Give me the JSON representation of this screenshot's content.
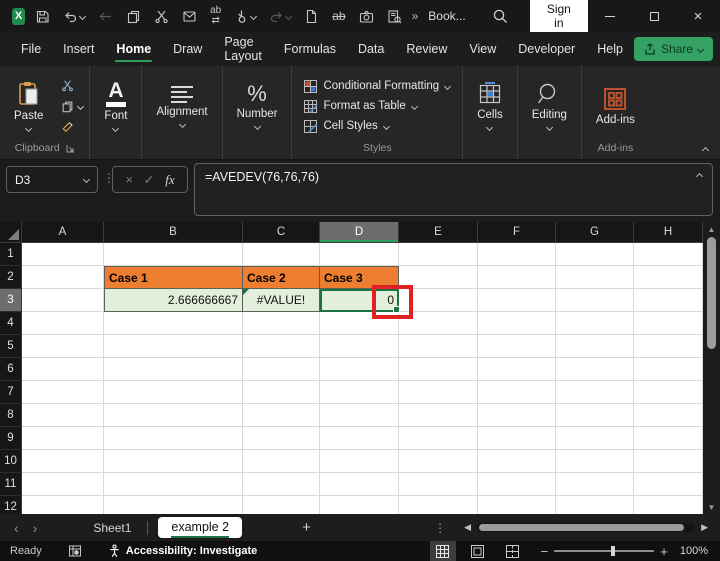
{
  "titlebar": {
    "document_title": "Book...",
    "sign_in_label": "Sign in",
    "overflow_glyph": "»",
    "find_replace_glyph": "ab",
    "find_replace_arrows": "⇄",
    "strikethrough_glyph": "ab",
    "excel_logo_glyph": "X"
  },
  "menubar": {
    "tabs": [
      {
        "label": "File",
        "active": false
      },
      {
        "label": "Insert",
        "active": false
      },
      {
        "label": "Home",
        "active": true
      },
      {
        "label": "Draw",
        "active": false
      },
      {
        "label": "Page Layout",
        "active": false
      },
      {
        "label": "Formulas",
        "active": false
      },
      {
        "label": "Data",
        "active": false
      },
      {
        "label": "Review",
        "active": false
      },
      {
        "label": "View",
        "active": false
      },
      {
        "label": "Developer",
        "active": false
      },
      {
        "label": "Help",
        "active": false
      }
    ],
    "share_label": "Share"
  },
  "ribbon": {
    "paste_label": "Paste",
    "clipboard_group_label": "Clipboard",
    "font_label": "Font",
    "alignment_label": "Alignment",
    "number_label": "Number",
    "number_glyph": "%",
    "conditional_formatting_label": "Conditional Formatting",
    "format_as_table_label": "Format as Table",
    "cell_styles_label": "Cell Styles",
    "styles_group_label": "Styles",
    "cells_label": "Cells",
    "editing_label": "Editing",
    "addins_label": "Add-ins",
    "addins_group_label": "Add-ins",
    "font_icon_glyph": "A"
  },
  "formula_bar": {
    "name_box_value": "D3",
    "cancel_glyph": "×",
    "enter_glyph": "✓",
    "fx_label": "fx",
    "formula": "=AVEDEV(76,76,76)"
  },
  "grid": {
    "column_headers": [
      "A",
      "B",
      "C",
      "D",
      "E",
      "F",
      "G",
      "H"
    ],
    "selected_column": "D",
    "row_headers": [
      "1",
      "2",
      "3",
      "4",
      "5",
      "6",
      "7",
      "8",
      "9",
      "10",
      "11",
      "12"
    ],
    "selected_row": "3",
    "cells": [
      {
        "ref": "B2",
        "value": "Case 1",
        "kind": "case-header"
      },
      {
        "ref": "C2",
        "value": "Case 2",
        "kind": "case-header"
      },
      {
        "ref": "D2",
        "value": "Case 3",
        "kind": "case-header"
      },
      {
        "ref": "B3",
        "value": "2.666666667",
        "kind": "result"
      },
      {
        "ref": "C3",
        "value": "#VALUE!",
        "kind": "error"
      },
      {
        "ref": "D3",
        "value": "0",
        "kind": "result-selected"
      }
    ]
  },
  "sheet_bar": {
    "tabs": [
      {
        "label": "Sheet1",
        "active": false
      },
      {
        "label": "example 2",
        "active": true
      }
    ],
    "add_sheet_glyph": "+"
  },
  "status_bar": {
    "mode": "Ready",
    "accessibility": "Accessibility: Investigate",
    "zoom_level": "100%"
  },
  "colors": {
    "accent_green": "#1e7145",
    "share_green": "#35a164",
    "case_header_orange": "#ED7D31",
    "result_green": "#E2EFDA",
    "annotation_red": "#e02222"
  }
}
